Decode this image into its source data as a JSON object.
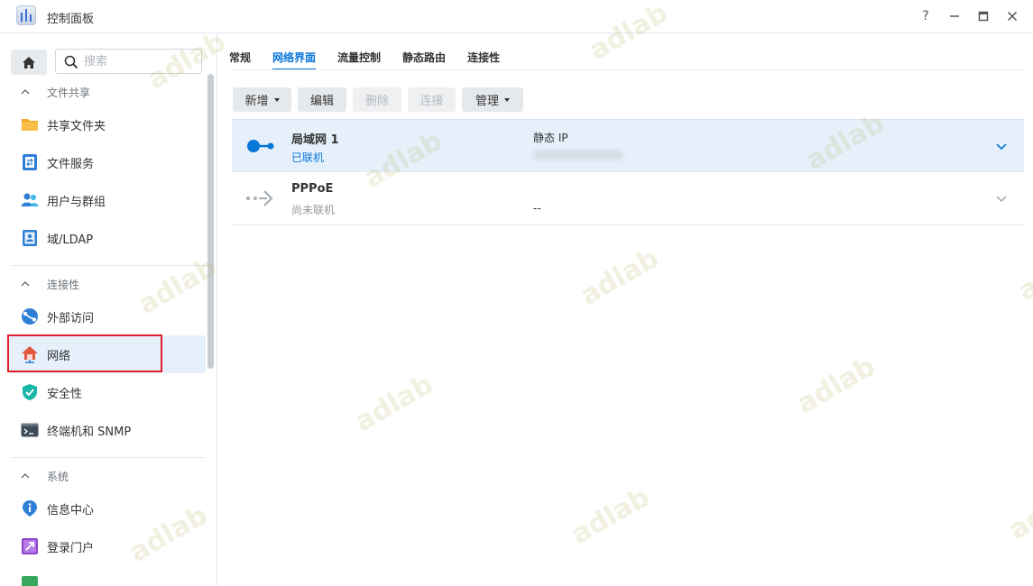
{
  "window": {
    "title": "控制面板",
    "controls": [
      "?",
      "—",
      "□",
      "✕"
    ]
  },
  "sidebar": {
    "search_placeholder": "搜索",
    "sections": [
      {
        "label": "文件共享",
        "items": [
          {
            "label": "共享文件夹",
            "icon": "shared-folder-icon"
          },
          {
            "label": "文件服务",
            "icon": "file-services-icon"
          },
          {
            "label": "用户与群组",
            "icon": "users-groups-icon"
          },
          {
            "label": "域/LDAP",
            "icon": "domain-ldap-icon"
          }
        ]
      },
      {
        "label": "连接性",
        "items": [
          {
            "label": "外部访问",
            "icon": "external-access-icon"
          },
          {
            "label": "网络",
            "icon": "network-icon",
            "active": true
          },
          {
            "label": "安全性",
            "icon": "security-shield-icon"
          },
          {
            "label": "终端机和 SNMP",
            "icon": "terminal-icon"
          }
        ]
      },
      {
        "label": "系统",
        "items": [
          {
            "label": "信息中心",
            "icon": "info-center-icon"
          },
          {
            "label": "登录门户",
            "icon": "login-portal-icon"
          }
        ]
      }
    ]
  },
  "main": {
    "tabs": [
      "常规",
      "网络界面",
      "流量控制",
      "静态路由",
      "连接性"
    ],
    "active_tab": "网络界面",
    "toolbar": {
      "create": "新增",
      "edit": "编辑",
      "delete": "删除",
      "connect": "连接",
      "manage": "管理"
    },
    "interfaces": [
      {
        "name": "局域网 1",
        "status": "已联机",
        "ip_mode": "静态 IP",
        "ip": ""
      },
      {
        "name": "PPPoE",
        "status": "尚未联机",
        "ip_mode": "",
        "ip": "--"
      }
    ]
  },
  "watermark": "adlab",
  "colors": {
    "accent": "#0875d9",
    "selected_bg": "#e5f0fb",
    "highlight": "#e0212b"
  }
}
